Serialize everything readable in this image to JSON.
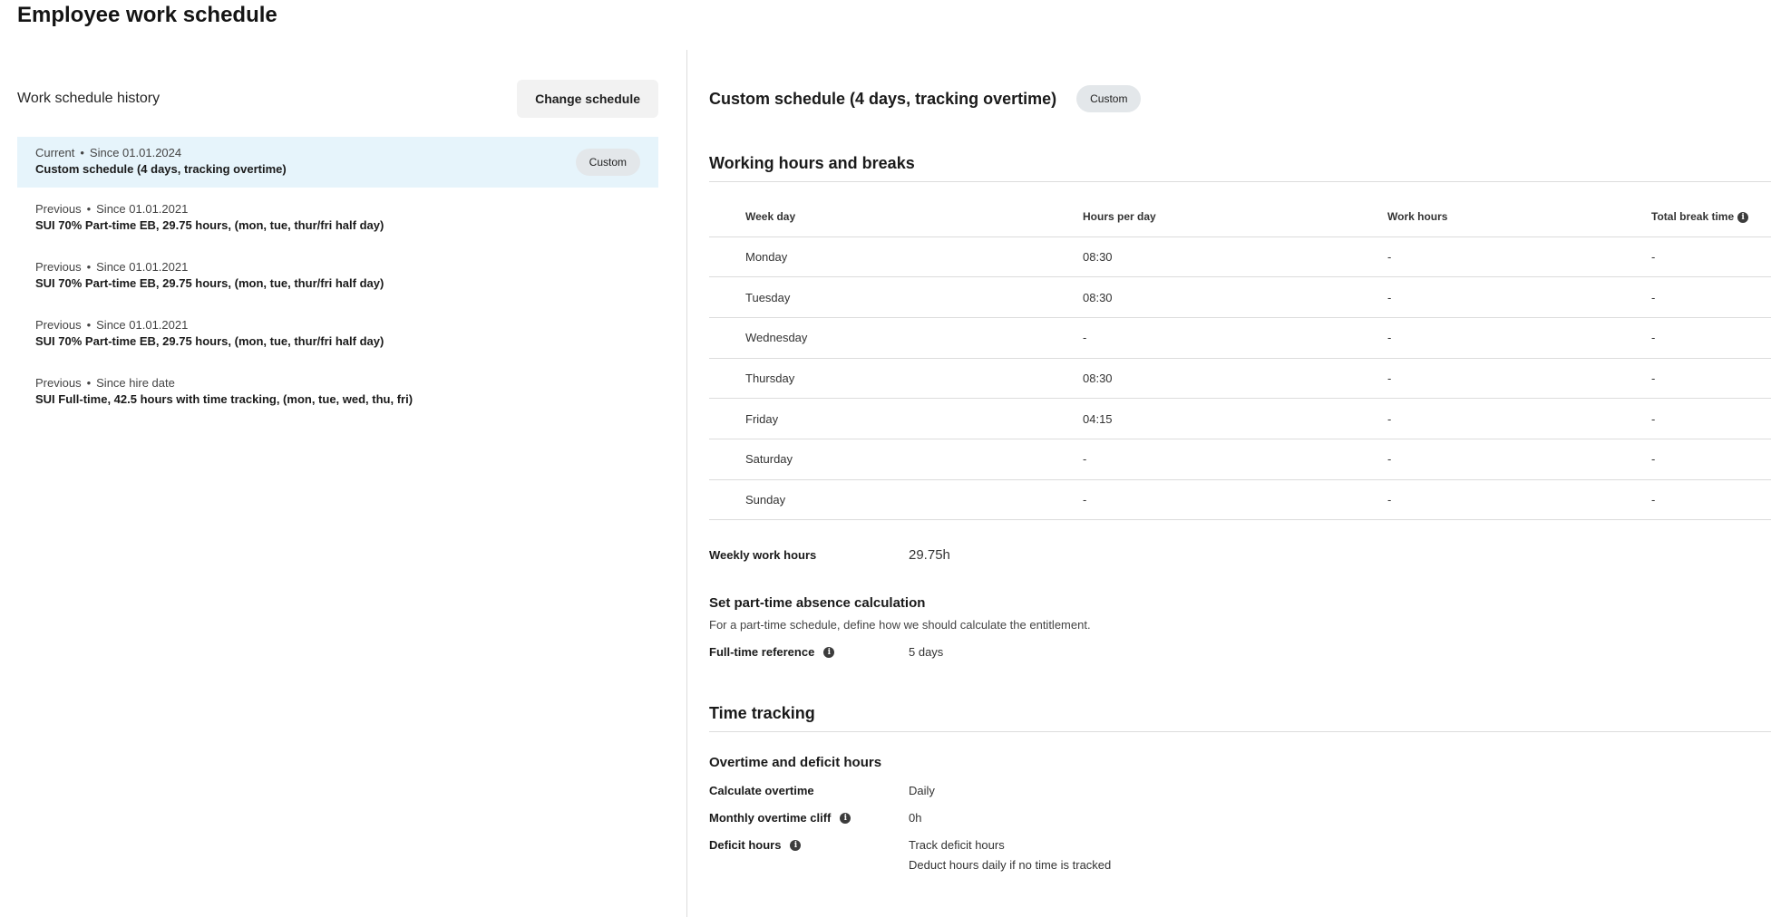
{
  "page_title": "Employee work schedule",
  "history": {
    "title": "Work schedule history",
    "change_button": "Change schedule",
    "items": [
      {
        "status": "Current",
        "since": "Since 01.01.2024",
        "name": "Custom schedule (4 days, tracking overtime)",
        "badge": "Custom"
      },
      {
        "status": "Previous",
        "since": "Since 01.01.2021",
        "name": "SUI 70% Part-time EB, 29.75 hours, (mon, tue,  thur/fri half day)"
      },
      {
        "status": "Previous",
        "since": "Since 01.01.2021",
        "name": "SUI 70% Part-time EB, 29.75 hours, (mon, tue,  thur/fri half day)"
      },
      {
        "status": "Previous",
        "since": "Since 01.01.2021",
        "name": "SUI 70% Part-time EB, 29.75 hours, (mon, tue,  thur/fri half day)"
      },
      {
        "status": "Previous",
        "since": "Since hire date",
        "name": "SUI Full-time, 42.5 hours with time tracking, (mon, tue, wed, thu, fri)"
      }
    ],
    "dot": "•"
  },
  "detail": {
    "title": "Custom schedule (4 days, tracking overtime)",
    "badge": "Custom",
    "hours_section": {
      "title": "Working hours and breaks",
      "columns": [
        "Week day",
        "Hours per day",
        "Work hours",
        "Total break time"
      ],
      "rows": [
        [
          "Monday",
          "08:30",
          "-",
          "-"
        ],
        [
          "Tuesday",
          "08:30",
          "-",
          "-"
        ],
        [
          "Wednesday",
          "-",
          "-",
          "-"
        ],
        [
          "Thursday",
          "08:30",
          "-",
          "-"
        ],
        [
          "Friday",
          "04:15",
          "-",
          "-"
        ],
        [
          "Saturday",
          "-",
          "-",
          "-"
        ],
        [
          "Sunday",
          "-",
          "-",
          "-"
        ]
      ]
    },
    "weekly_label": "Weekly work hours",
    "weekly_value": "29.75h",
    "parttime": {
      "title": "Set part-time absence calculation",
      "description": "For a part-time schedule, define how we should calculate the entitlement.",
      "fulltime_label": "Full-time reference",
      "fulltime_value": "5 days"
    },
    "tracking": {
      "title": "Time tracking",
      "overtime_title": "Overtime and deficit hours",
      "calc_label": "Calculate overtime",
      "calc_value": "Daily",
      "cliff_label": "Monthly overtime cliff",
      "cliff_value": "0h",
      "deficit_label": "Deficit hours",
      "deficit_value": "Track deficit hours",
      "deficit_extra": "Deduct hours daily if no time is tracked"
    },
    "info_glyph": "i"
  }
}
